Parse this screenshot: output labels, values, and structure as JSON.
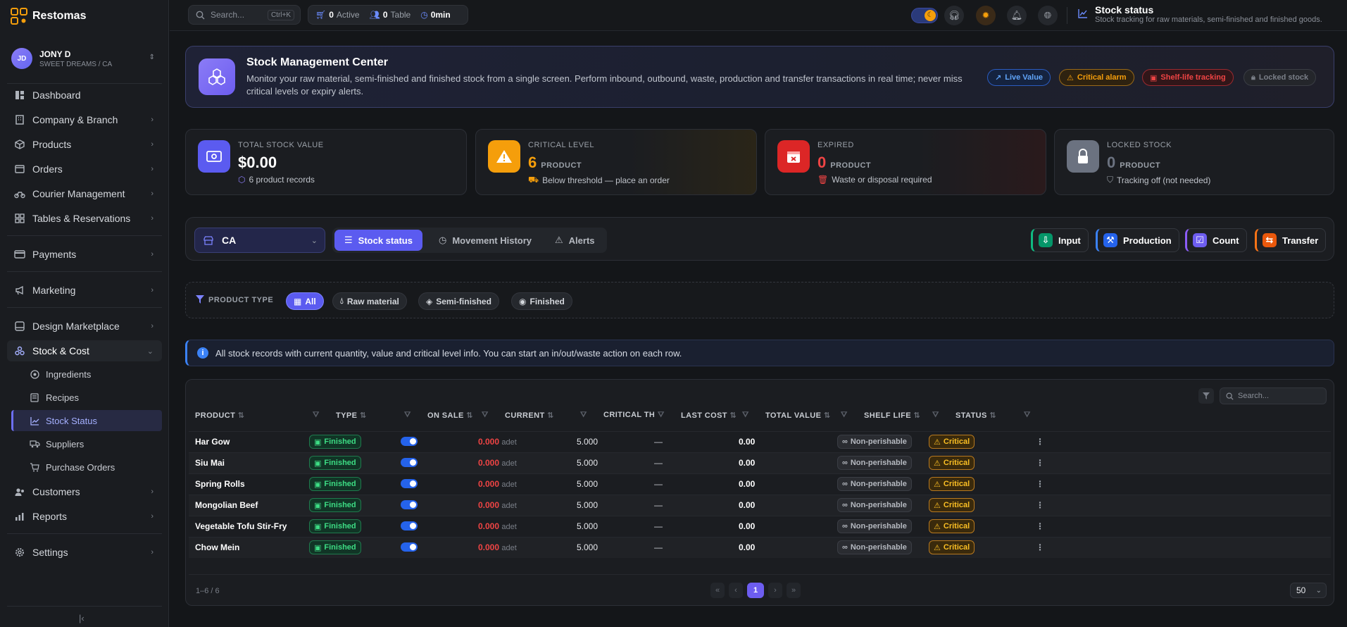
{
  "app": {
    "name": "Restomas"
  },
  "user": {
    "initials": "JD",
    "name": "JONY D",
    "sub": "SWEET DREAMS / CA"
  },
  "sidebar": {
    "items": [
      {
        "label": "Dashboard",
        "icon": "dashboard-icon"
      },
      {
        "label": "Company & Branch",
        "icon": "building-icon"
      },
      {
        "label": "Products",
        "icon": "box-icon"
      },
      {
        "label": "Orders",
        "icon": "orders-icon"
      },
      {
        "label": "Courier Management",
        "icon": "bike-icon"
      },
      {
        "label": "Tables & Reservations",
        "icon": "table-icon"
      },
      {
        "label": "Payments",
        "icon": "card-icon"
      },
      {
        "label": "Marketing",
        "icon": "megaphone-icon"
      },
      {
        "label": "Design Marketplace",
        "icon": "palette-icon"
      },
      {
        "label": "Stock & Cost",
        "icon": "layers-icon"
      },
      {
        "label": "Customers",
        "icon": "users-icon"
      },
      {
        "label": "Reports",
        "icon": "bar-chart-icon"
      },
      {
        "label": "Settings",
        "icon": "gear-icon"
      }
    ],
    "sub": [
      {
        "label": "Ingredients"
      },
      {
        "label": "Recipes"
      },
      {
        "label": "Stock Status"
      },
      {
        "label": "Suppliers"
      },
      {
        "label": "Purchase Orders"
      }
    ]
  },
  "topbar": {
    "search_placeholder": "Search...",
    "shortcut": "Ctrl+K",
    "active_count": "0",
    "active_label": "Active",
    "table_count": "0",
    "table_label": "Table",
    "time": "0min",
    "page_title": "Stock status",
    "page_sub": "Stock tracking for raw materials, semi-finished and finished goods."
  },
  "hero": {
    "title": "Stock Management Center",
    "desc": "Monitor your raw material, semi-finished and finished stock from a single screen. Perform inbound, outbound, waste, production and transfer transactions in real time; never miss critical levels or expiry alerts.",
    "tags": [
      "Live Value",
      "Critical alarm",
      "Shelf-life tracking",
      "Locked stock"
    ]
  },
  "stats": [
    {
      "label": "TOTAL STOCK VALUE",
      "value": "$0.00",
      "unit": "",
      "sub": "6 product records",
      "color": "#ffffff"
    },
    {
      "label": "CRITICAL LEVEL",
      "value": "6",
      "unit": "PRODUCT",
      "sub": "Below threshold — place an order",
      "color": "#f59e0b"
    },
    {
      "label": "EXPIRED",
      "value": "0",
      "unit": "PRODUCT",
      "sub": "Waste or disposal required",
      "color": "#ef4444"
    },
    {
      "label": "LOCKED STOCK",
      "value": "0",
      "unit": "PRODUCT",
      "sub": "Tracking off (not needed)",
      "color": "#6b7280"
    }
  ],
  "toolbar": {
    "branch": "CA",
    "tabs": [
      "Stock status",
      "Movement History",
      "Alerts"
    ],
    "actions": [
      "Input",
      "Production",
      "Count",
      "Transfer"
    ]
  },
  "filter": {
    "label": "PRODUCT TYPE",
    "chips": [
      "All",
      "Raw material",
      "Semi-finished",
      "Finished"
    ]
  },
  "info": {
    "text": "All stock records with current quantity, value and critical level info. You can start an in/out/waste action on each row."
  },
  "table": {
    "search_placeholder": "Search...",
    "headers": [
      "PRODUCT",
      "TYPE",
      "ON SALE",
      "CURRENT",
      "CRITICAL TH",
      "LAST COST",
      "TOTAL VALUE",
      "SHELF LIFE",
      "STATUS"
    ],
    "rows": [
      {
        "product": "Har Gow",
        "type": "Finished",
        "current": "0.000",
        "unit": "adet",
        "critical": "5.000",
        "last_cost": "—",
        "total": "0.00",
        "shelf": "Non-perishable",
        "status": "Critical"
      },
      {
        "product": "Siu Mai",
        "type": "Finished",
        "current": "0.000",
        "unit": "adet",
        "critical": "5.000",
        "last_cost": "—",
        "total": "0.00",
        "shelf": "Non-perishable",
        "status": "Critical"
      },
      {
        "product": "Spring Rolls",
        "type": "Finished",
        "current": "0.000",
        "unit": "adet",
        "critical": "5.000",
        "last_cost": "—",
        "total": "0.00",
        "shelf": "Non-perishable",
        "status": "Critical"
      },
      {
        "product": "Mongolian Beef",
        "type": "Finished",
        "current": "0.000",
        "unit": "adet",
        "critical": "5.000",
        "last_cost": "—",
        "total": "0.00",
        "shelf": "Non-perishable",
        "status": "Critical"
      },
      {
        "product": "Vegetable Tofu Stir-Fry",
        "type": "Finished",
        "current": "0.000",
        "unit": "adet",
        "critical": "5.000",
        "last_cost": "—",
        "total": "0.00",
        "shelf": "Non-perishable",
        "status": "Critical"
      },
      {
        "product": "Chow Mein",
        "type": "Finished",
        "current": "0.000",
        "unit": "adet",
        "critical": "5.000",
        "last_cost": "—",
        "total": "0.00",
        "shelf": "Non-perishable",
        "status": "Critical"
      }
    ],
    "range": "1–6 / 6",
    "page": "1",
    "page_size": "50"
  }
}
